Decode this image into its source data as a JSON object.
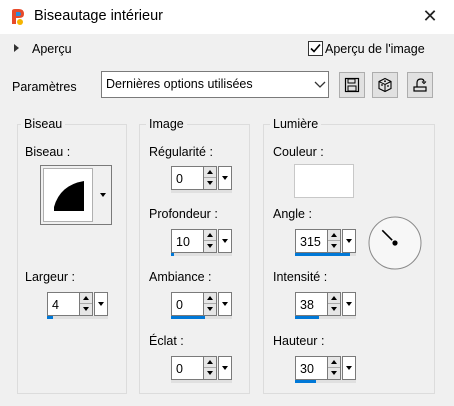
{
  "window": {
    "title": "Biseautage intérieur"
  },
  "preview": {
    "label": "Aperçu",
    "checkbox_label": "Aperçu de l'image",
    "checked": true
  },
  "params": {
    "label": "Paramètres",
    "preset_value": "Dernières options utilisées"
  },
  "groups": {
    "biseau": {
      "title": "Biseau",
      "shape_label": "Biseau :",
      "width_label": "Largeur :"
    },
    "image": {
      "title": "Image",
      "regularity_label": "Régularité :",
      "depth_label": "Profondeur :",
      "ambience_label": "Ambiance :",
      "shine_label": "Éclat :"
    },
    "light": {
      "title": "Lumière",
      "color_label": "Couleur :",
      "angle_label": "Angle :",
      "intensity_label": "Intensité :",
      "height_label": "Hauteur :"
    }
  },
  "fields": {
    "largeur": {
      "value": "4",
      "fill": 0.1
    },
    "regularite": {
      "value": "0",
      "fill": 0.0
    },
    "profondeur": {
      "value": "10",
      "fill": 0.05
    },
    "ambiance": {
      "value": "0",
      "fill": 0.55
    },
    "eclat": {
      "value": "0",
      "fill": 0.0
    },
    "angle": {
      "value": "315",
      "fill": 0.9
    },
    "intensite": {
      "value": "38",
      "fill": 0.4
    },
    "hauteur": {
      "value": "30",
      "fill": 0.35
    }
  },
  "light_color": "#ffffff",
  "accent_color": "#0078d7",
  "icons": [
    "app-logo-icon",
    "close-icon",
    "expand-arrow-icon",
    "checkbox-checked-icon",
    "save-icon",
    "load-preset-icon",
    "randomize-icon"
  ]
}
